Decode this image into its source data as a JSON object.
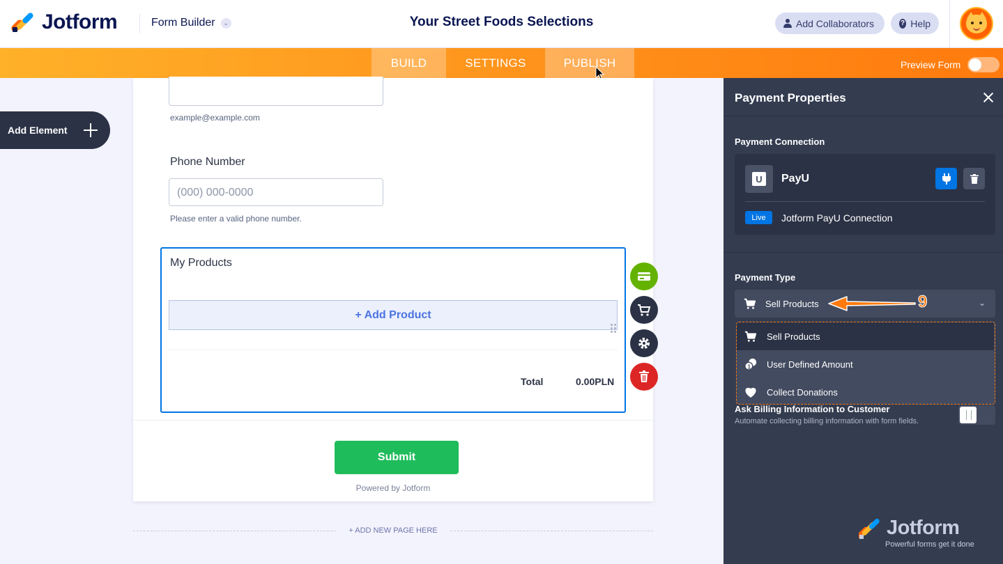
{
  "header": {
    "brand": "Jotform",
    "section": "Form Builder",
    "form_title": "Your Street Foods Selections",
    "collaborators_label": "Add Collaborators",
    "help_label": "Help"
  },
  "nav": {
    "tabs": [
      "BUILD",
      "SETTINGS",
      "PUBLISH"
    ],
    "preview_label": "Preview Form",
    "preview_enabled": false
  },
  "sidebar": {
    "add_element_label": "Add Element"
  },
  "form": {
    "email_hint": "example@example.com",
    "phone_label": "Phone Number",
    "phone_placeholder": "(000) 000-0000",
    "phone_hint": "Please enter a valid phone number.",
    "products_title": "My Products",
    "add_product_label": "+ Add Product",
    "total_label": "Total",
    "total_value": "0.00PLN",
    "submit_label": "Submit",
    "powered_by": "Powered by Jotform",
    "add_page_label": "+ ADD NEW PAGE HERE"
  },
  "payment_panel": {
    "title": "Payment Properties",
    "connection_label": "Payment Connection",
    "gateway_name": "PayU",
    "status_badge": "Live",
    "connection_name": "Jotform PayU Connection",
    "payment_type_label": "Payment Type",
    "selected_type": "Sell Products",
    "options": [
      "Sell Products",
      "User Defined Amount",
      "Collect Donations"
    ],
    "billing_title": "Ask Billing Information to Customer",
    "billing_desc": "Automate collecting billing information with form fields.",
    "brand": "Jotform",
    "brand_tagline": "Powerful forms get it done"
  },
  "annotation": {
    "step_number": "9"
  },
  "colors": {
    "accent_orange": "#ff7a0d",
    "primary_blue": "#0075e3",
    "submit_green": "#1fbc5b",
    "panel_bg": "#343c50"
  }
}
